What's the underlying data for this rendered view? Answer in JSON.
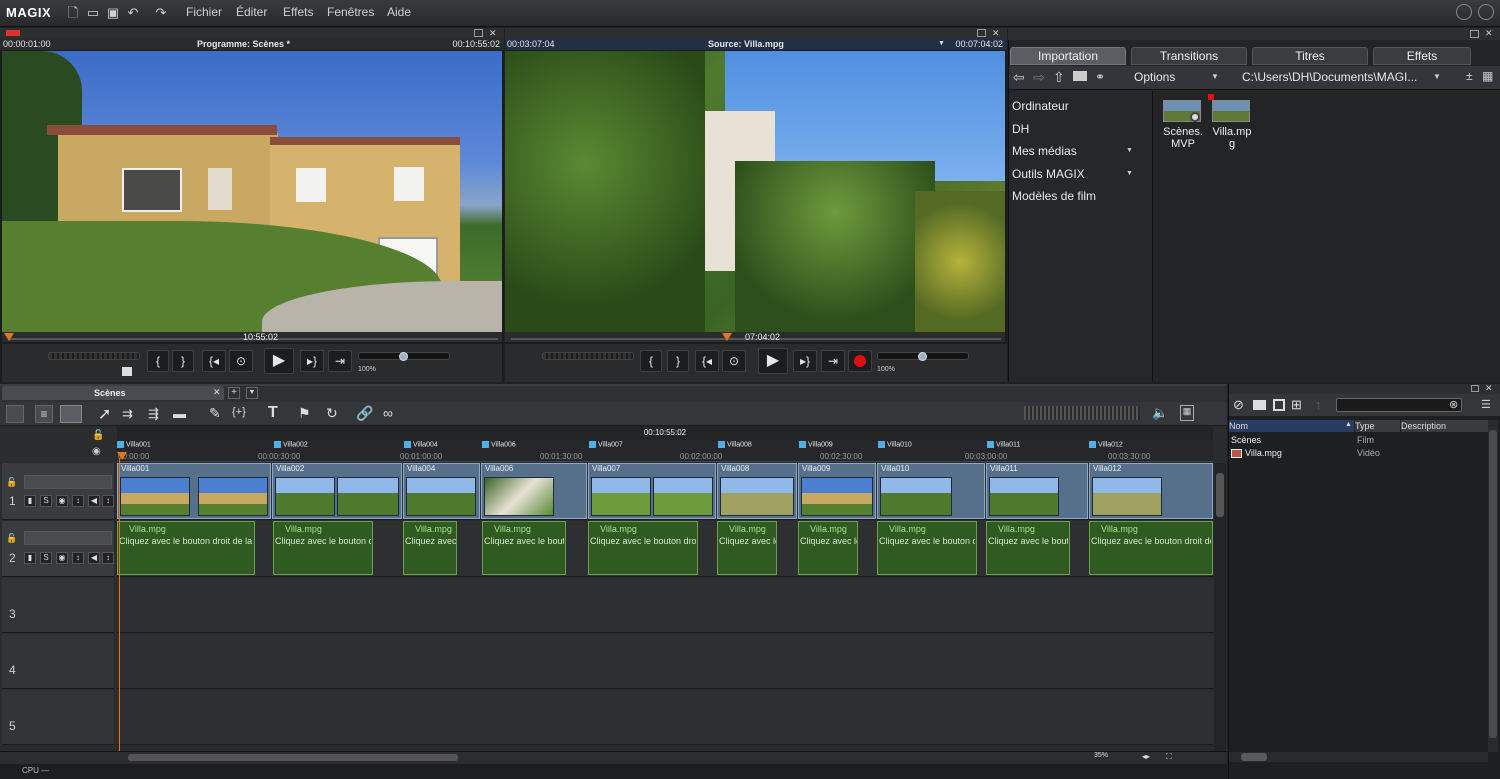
{
  "app": {
    "logo": "MAGIX"
  },
  "menu": [
    "Fichier",
    "Éditer",
    "Effets",
    "Fenêtres",
    "Aide"
  ],
  "program_monitor": {
    "timecode_left": "00:00:01:00",
    "title": "Programme: Scènes *",
    "timecode_right": "00:10:55:02",
    "position": "10:55:02",
    "zoom": "100%"
  },
  "source_monitor": {
    "timecode_left": "00:03:07:04",
    "title": "Source: Villa.mpg",
    "timecode_right": "00:07:04:02",
    "position": "07:04:02",
    "zoom": "100%"
  },
  "transport_glyphs": {
    "mark_in": "{",
    "mark_out": "}",
    "prev": "{◂",
    "play": "▶",
    "next": "▸}",
    "jump": "⇥"
  },
  "importer": {
    "tabs": [
      "Importation",
      "Transitions",
      "Titres",
      "Effets"
    ],
    "options_label": "Options",
    "path": "C:\\Users\\DH\\Documents\\MAGI...",
    "nav_items": [
      "Ordinateur",
      "DH",
      "Mes médias",
      "Outils MAGIX",
      "Modèles de film"
    ],
    "files": [
      {
        "name": "Scènes. MVP"
      },
      {
        "name": "Villa.mp g"
      }
    ]
  },
  "arranger": {
    "tab_title": "Scènes",
    "position_timecode": "00:10:55:02",
    "markers": [
      "Villa001",
      "Villa002",
      "Villa004",
      "Villa006",
      "Villa007",
      "Villa008",
      "Villa009",
      "Villa010",
      "Villa011",
      "Villa012"
    ],
    "ruler_ticks": [
      "00:00:00",
      "00:00:30:00",
      "00:01:00:00",
      "00:01:30:00",
      "00:02:00:00",
      "00:02:30:00",
      "00:03:00:00",
      "00:03:30:00"
    ],
    "track_numbers": [
      "1",
      "2",
      "3",
      "4",
      "5"
    ],
    "track_buttons": {
      "solo": "S",
      "mute": "M"
    },
    "video_clips": [
      "Villa001",
      "Villa002",
      "Villa004",
      "Villa006",
      "Villa007",
      "Villa008",
      "Villa009",
      "Villa010",
      "Villa011",
      "Villa012"
    ],
    "audio_clip_name": "Villa.mpg",
    "audio_clip_hint": "Cliquez avec le bouton droit de la...",
    "zoom": "35%"
  },
  "media_pool": {
    "columns": [
      "Nom",
      "Type",
      "Description"
    ],
    "rows": [
      {
        "name": "Scènes",
        "type": "Film"
      },
      {
        "name": "Villa.mpg",
        "type": "Vidéo"
      }
    ]
  },
  "status": {
    "cpu": "CPU —"
  },
  "colors": {
    "accent": "#4fb0e6",
    "video_clip": "#56708c",
    "audio_clip": "#2f5a22",
    "record": "#e01010",
    "playhead": "#e8751a"
  }
}
